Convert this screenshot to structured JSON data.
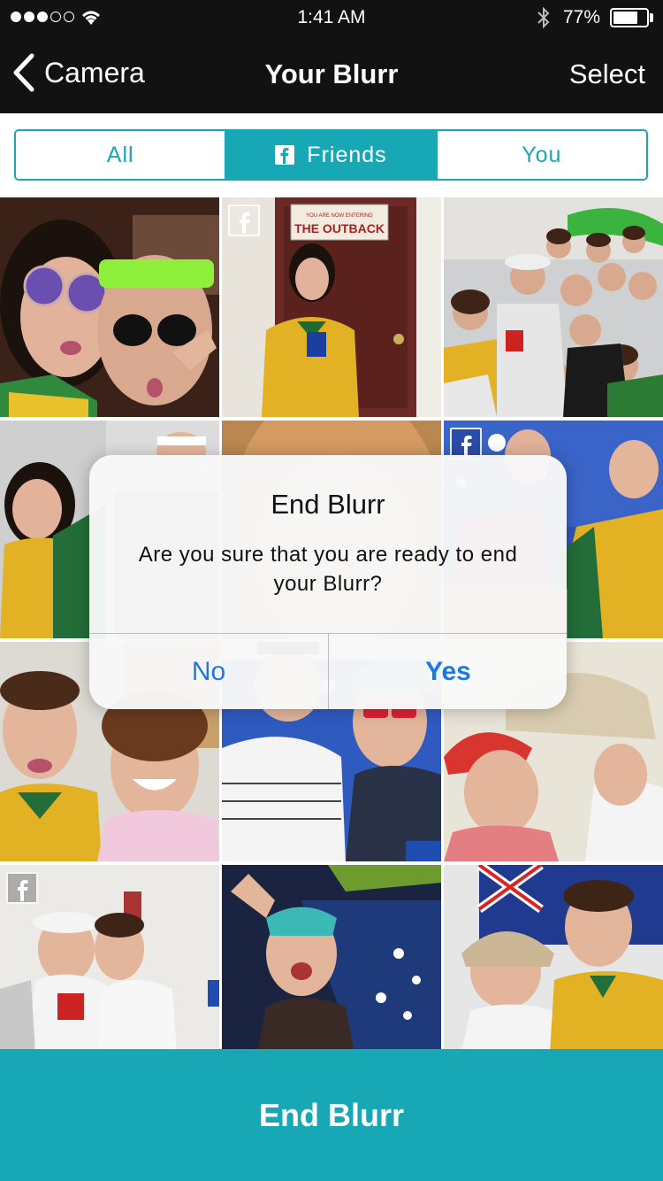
{
  "status_bar": {
    "time": "1:41 AM",
    "battery_percent": "77%",
    "battery_level": 0.77,
    "signal_dots_filled": 3,
    "signal_dots_total": 5,
    "icons": [
      "signal-icon",
      "wifi-icon",
      "bluetooth-icon",
      "battery-icon"
    ]
  },
  "nav": {
    "back_label": "Camera",
    "title": "Your Blurr",
    "select_label": "Select"
  },
  "tabs": {
    "items": [
      {
        "label": "All",
        "active": false
      },
      {
        "label": "Friends",
        "active": true,
        "icon": "facebook-icon"
      },
      {
        "label": "You",
        "active": false
      }
    ]
  },
  "photos": [
    {
      "facebook_badge": false
    },
    {
      "facebook_badge": true,
      "sign_text": "YOU ARE NOW ENTERING THE OUTBACK"
    },
    {
      "facebook_badge": false
    },
    {
      "facebook_badge": false
    },
    {
      "facebook_badge": false
    },
    {
      "facebook_badge": true
    },
    {
      "facebook_badge": false
    },
    {
      "facebook_badge": false
    },
    {
      "facebook_badge": false
    },
    {
      "facebook_badge": true
    },
    {
      "facebook_badge": false
    },
    {
      "facebook_badge": false
    }
  ],
  "alert": {
    "title": "End Blurr",
    "message": "Are you sure that you are ready to end your Blurr?",
    "no_label": "No",
    "yes_label": "Yes"
  },
  "bottom_button": {
    "label": "End Blurr"
  },
  "colors": {
    "accent": "#18a8b5",
    "nav_background": "#121212",
    "alert_button": "#1879e6"
  }
}
